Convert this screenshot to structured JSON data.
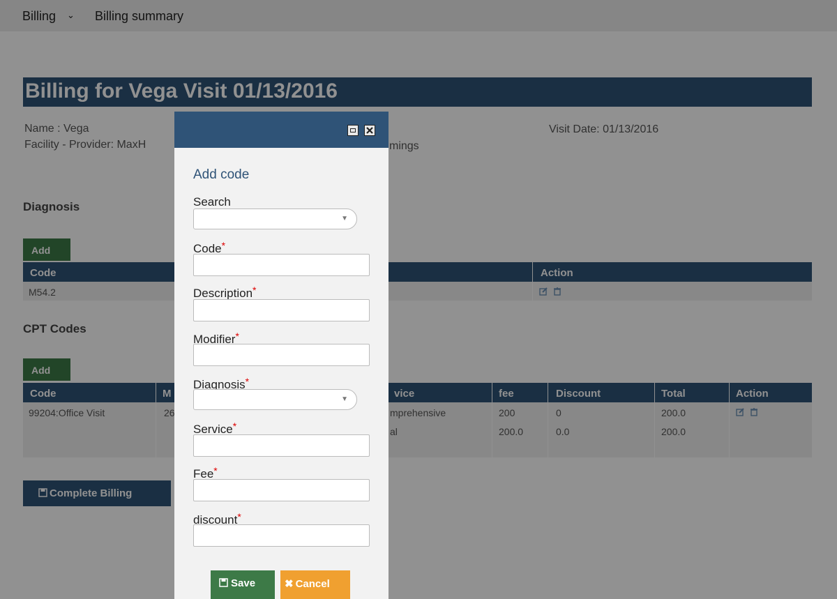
{
  "nav": {
    "menu_label": "Billing",
    "menu_chevron": "⌄",
    "current": "Billing summary"
  },
  "page": {
    "title": "Billing for Vega Visit 01/13/2016",
    "name_line": "Name : Vega",
    "facility_line_start": "Facility - Provider: MaxH",
    "facility_line_end": "mings",
    "visit_date": "Visit Date: 01/13/2016"
  },
  "diagnosis": {
    "title": "Diagnosis",
    "add_label": "Add",
    "headers": {
      "code": "Code",
      "action": "Action"
    },
    "rows": [
      {
        "code": "M54.2"
      }
    ]
  },
  "cpt": {
    "title": "CPT Codes",
    "add_label": "Add",
    "headers": {
      "code": "Code",
      "modifier_partial": "M",
      "service_partial": "vice",
      "fee": "fee",
      "discount": "Discount",
      "total": "Total",
      "action": "Action"
    },
    "rows": [
      {
        "code": "99204:Office Visit",
        "modifier_partial": "26",
        "service_partial": "mprehensive",
        "fee": "200",
        "discount": "0",
        "total": "200.0"
      }
    ],
    "totals": {
      "label_partial": "al",
      "fee": "200.0",
      "discount": "0.0",
      "total": "200.0"
    }
  },
  "complete_billing_label": "Complete Billing",
  "modal": {
    "title": "Add code",
    "fields": {
      "search": "Search",
      "code": "Code",
      "description": "Description",
      "modifier": "Modifier",
      "diagnosis": "Diagnosis",
      "service": "Service",
      "fee": "Fee",
      "discount": "discount"
    },
    "required_mark": "*",
    "save_label": "Save",
    "cancel_label": "Cancel"
  },
  "colors": {
    "header_blue": "#2f5377",
    "add_green": "#3d7a47",
    "cancel_orange": "#f0a030",
    "required_red": "#d00000"
  },
  "icons": [
    "chevron-down-icon",
    "edit-icon",
    "trash-icon",
    "save-icon",
    "maximize-icon",
    "close-icon",
    "close-x-icon",
    "dropdown-caret-icon"
  ]
}
